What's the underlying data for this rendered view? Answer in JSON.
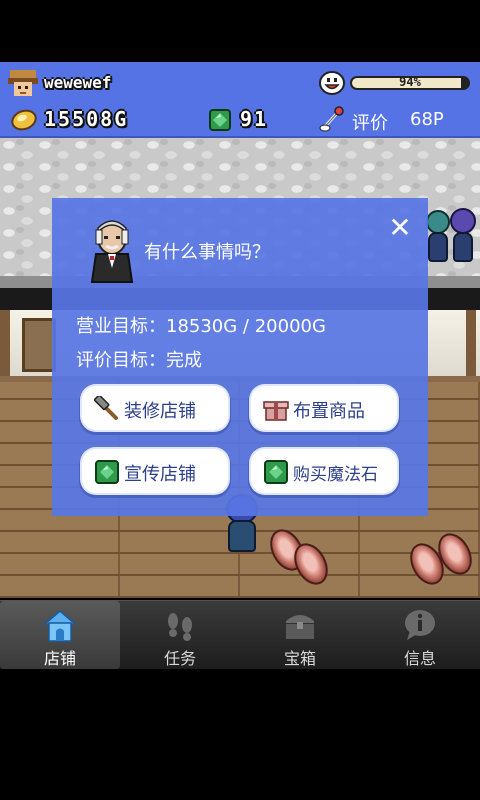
{
  "hud": {
    "player_name": "wewewef",
    "mood_percent": 94,
    "mood_text": "94%",
    "gold": "15508G",
    "gems": "91",
    "rating_label": "评价",
    "rating_value": "68P"
  },
  "dialog": {
    "question": "有什么事情吗？",
    "close_symbol": "✕",
    "sales_target_label": "营业目标：",
    "sales_target_value": "18530G / 20000G",
    "rating_target_label": "评价目标：",
    "rating_target_value": "完成",
    "buttons": {
      "renovate": "装修店铺",
      "arrange": "布置商品",
      "promote": "宣传店铺",
      "buy_magic_stone": "购买魔法石"
    }
  },
  "tabs": [
    {
      "label": "店铺",
      "icon": "house-icon",
      "active": true
    },
    {
      "label": "任务",
      "icon": "footprints-icon",
      "active": false
    },
    {
      "label": "宝箱",
      "icon": "treasure-chest-icon",
      "active": false
    },
    {
      "label": "信息",
      "icon": "info-bubble-icon",
      "active": false
    }
  ],
  "colors": {
    "hud_background": "#5573e4",
    "dialog_background": "#5876e4",
    "button_text": "#2c3f8a",
    "tabbar_background": "#2a2a2a"
  }
}
